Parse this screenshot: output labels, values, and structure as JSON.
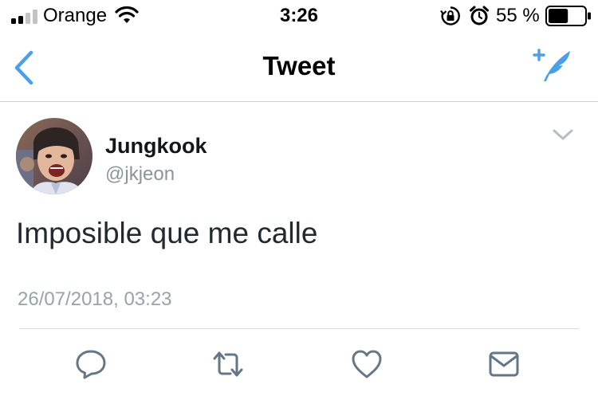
{
  "status_bar": {
    "carrier": "Orange",
    "time": "3:26",
    "battery_percent": "55 %",
    "battery_level": 0.55,
    "icons": [
      "signal-icon",
      "wifi-icon",
      "rotation-lock-icon",
      "alarm-icon",
      "battery-icon"
    ]
  },
  "nav": {
    "title": "Tweet",
    "back_icon": "chevron-left-icon",
    "compose_icon": "compose-tweet-icon"
  },
  "tweet": {
    "author_name": "Jungkook",
    "author_handle": "@jkjeon",
    "text": "Imposible que me calle",
    "timestamp": "26/07/2018, 03:23",
    "menu_icon": "chevron-down-icon"
  },
  "actions": [
    "reply-icon",
    "retweet-icon",
    "like-icon",
    "direct-message-icon"
  ],
  "colors": {
    "accent": "#4a9fe8",
    "icon_gray": "#657786",
    "secondary_text": "#8a949d",
    "divider": "#d7dce0"
  }
}
